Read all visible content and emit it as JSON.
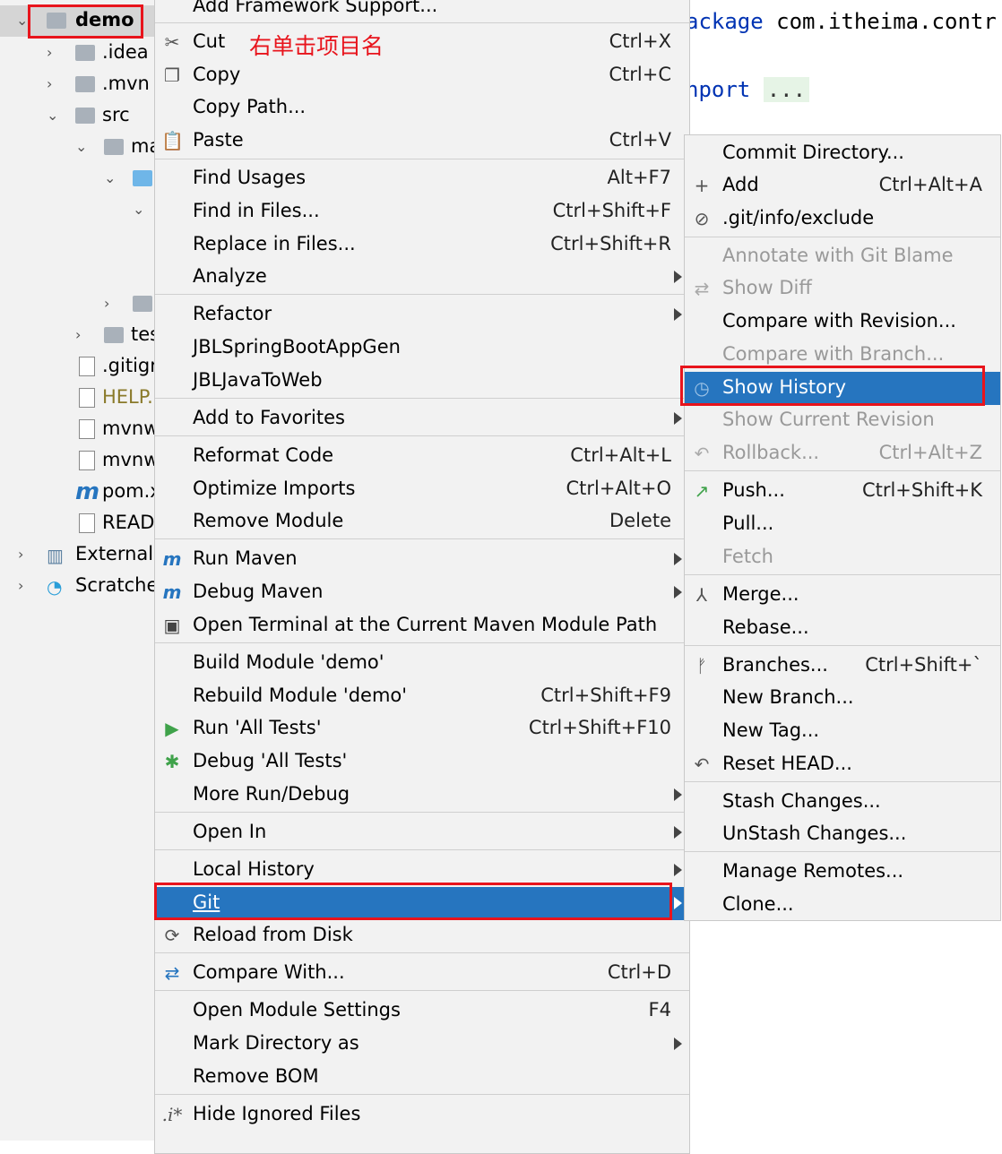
{
  "project_tree": {
    "root": "demo",
    "items": [
      {
        "label": ".idea",
        "type": "folder"
      },
      {
        "label": ".mvn",
        "type": "folder"
      },
      {
        "label": "src",
        "type": "folder"
      },
      {
        "label": "ma",
        "type": "folder"
      },
      {
        "label": "",
        "type": "folder-blue"
      },
      {
        "label": "",
        "type": "none"
      },
      {
        "label": "",
        "type": "folder"
      },
      {
        "label": "tes",
        "type": "folder"
      },
      {
        "label": ".gitigr",
        "type": "file"
      },
      {
        "label": "HELP.",
        "type": "md"
      },
      {
        "label": "mvnw",
        "type": "file"
      },
      {
        "label": "mvnw",
        "type": "file"
      },
      {
        "label": "pom.x",
        "type": "maven"
      },
      {
        "label": "READ",
        "type": "md"
      },
      {
        "label": "External",
        "type": "lib"
      },
      {
        "label": "Scratche",
        "type": "scratch"
      }
    ]
  },
  "editor": {
    "line1_keyword": "ackage",
    "line1_text": " com.itheima.contr",
    "line2_keyword": "nport",
    "line2_dots": "..."
  },
  "annotation": "右单击项目名",
  "main_menu": {
    "top_partial": "Add Framework Support...",
    "items": [
      {
        "label": "Cut",
        "shortcut": "Ctrl+X",
        "icon": "scissors-icon"
      },
      {
        "label": "Copy",
        "shortcut": "Ctrl+C",
        "icon": "copy-icon"
      },
      {
        "label": "Copy Path...",
        "shortcut": ""
      },
      {
        "label": "Paste",
        "shortcut": "Ctrl+V",
        "icon": "paste-icon"
      },
      {
        "label": "Find Usages",
        "shortcut": "Alt+F7"
      },
      {
        "label": "Find in Files...",
        "shortcut": "Ctrl+Shift+F"
      },
      {
        "label": "Replace in Files...",
        "shortcut": "Ctrl+Shift+R"
      },
      {
        "label": "Analyze",
        "shortcut": ""
      },
      {
        "label": "Refactor",
        "shortcut": ""
      },
      {
        "label": "JBLSpringBootAppGen",
        "shortcut": ""
      },
      {
        "label": "JBLJavaToWeb",
        "shortcut": ""
      },
      {
        "label": "Add to Favorites",
        "shortcut": ""
      },
      {
        "label": "Reformat Code",
        "shortcut": "Ctrl+Alt+L"
      },
      {
        "label": "Optimize Imports",
        "shortcut": "Ctrl+Alt+O"
      },
      {
        "label": "Remove Module",
        "shortcut": "Delete"
      },
      {
        "label": "Run Maven",
        "shortcut": ""
      },
      {
        "label": "Debug Maven",
        "shortcut": ""
      },
      {
        "label": "Open Terminal at the Current Maven Module Path",
        "shortcut": ""
      },
      {
        "label": "Build Module 'demo'",
        "shortcut": ""
      },
      {
        "label": "Rebuild Module 'demo'",
        "shortcut": "Ctrl+Shift+F9"
      },
      {
        "label": "Run 'All Tests'",
        "shortcut": "Ctrl+Shift+F10"
      },
      {
        "label": "Debug 'All Tests'",
        "shortcut": ""
      },
      {
        "label": "More Run/Debug",
        "shortcut": ""
      },
      {
        "label": "Open In",
        "shortcut": ""
      },
      {
        "label": "Local History",
        "shortcut": ""
      },
      {
        "label": "Git",
        "shortcut": ""
      },
      {
        "label": "Reload from Disk",
        "shortcut": ""
      },
      {
        "label": "Compare With...",
        "shortcut": "Ctrl+D"
      },
      {
        "label": "Open Module Settings",
        "shortcut": "F4"
      },
      {
        "label": "Mark Directory as",
        "shortcut": ""
      },
      {
        "label": "Remove BOM",
        "shortcut": ""
      },
      {
        "label": "Hide Ignored Files",
        "shortcut": ""
      }
    ]
  },
  "git_menu": {
    "items": [
      {
        "label": "Commit Directory...",
        "shortcut": ""
      },
      {
        "label": "Add",
        "shortcut": "Ctrl+Alt+A"
      },
      {
        "label": ".git/info/exclude",
        "shortcut": ""
      },
      {
        "label": "Annotate with Git Blame",
        "shortcut": ""
      },
      {
        "label": "Show Diff",
        "shortcut": ""
      },
      {
        "label": "Compare with Revision...",
        "shortcut": ""
      },
      {
        "label": "Compare with Branch...",
        "shortcut": ""
      },
      {
        "label": "Show History",
        "shortcut": ""
      },
      {
        "label": "Show Current Revision",
        "shortcut": ""
      },
      {
        "label": "Rollback...",
        "shortcut": "Ctrl+Alt+Z"
      },
      {
        "label": "Push...",
        "shortcut": "Ctrl+Shift+K"
      },
      {
        "label": "Pull...",
        "shortcut": ""
      },
      {
        "label": "Fetch",
        "shortcut": ""
      },
      {
        "label": "Merge...",
        "shortcut": ""
      },
      {
        "label": "Rebase...",
        "shortcut": ""
      },
      {
        "label": "Branches...",
        "shortcut": "Ctrl+Shift+`"
      },
      {
        "label": "New Branch...",
        "shortcut": ""
      },
      {
        "label": "New Tag...",
        "shortcut": ""
      },
      {
        "label": "Reset HEAD...",
        "shortcut": ""
      },
      {
        "label": "Stash Changes...",
        "shortcut": ""
      },
      {
        "label": "UnStash Changes...",
        "shortcut": ""
      },
      {
        "label": "Manage Remotes...",
        "shortcut": ""
      },
      {
        "label": "Clone...",
        "shortcut": ""
      }
    ]
  },
  "colors": {
    "highlight": "#2675bf",
    "annotation_red": "#e8141c",
    "menu_bg": "#f2f2f2"
  }
}
